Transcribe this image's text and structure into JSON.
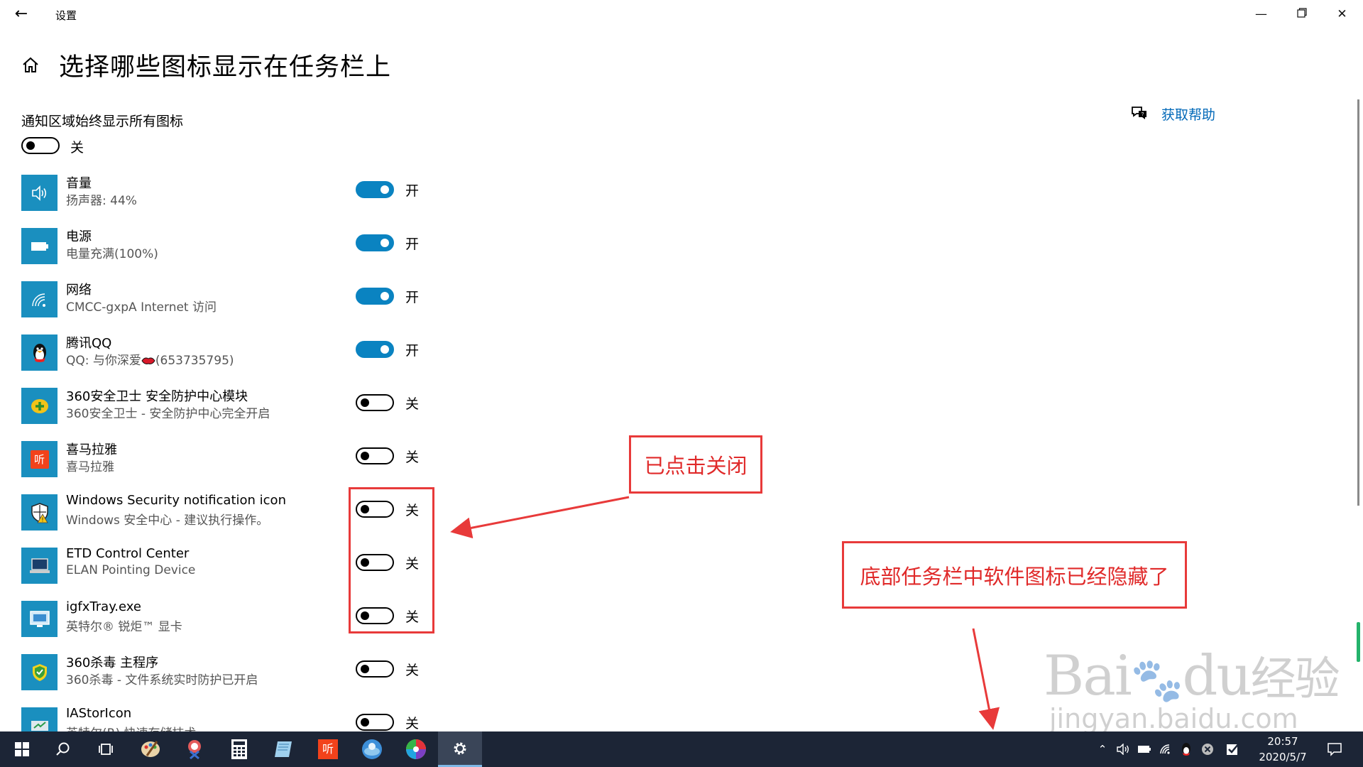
{
  "window": {
    "title": "设置",
    "back_icon": "back-arrow-icon",
    "controls": [
      "minimize-icon",
      "restore-icon",
      "close-icon"
    ]
  },
  "header": {
    "title": "选择哪些图标显示在任务栏上",
    "help_label": "获取帮助"
  },
  "always_show": {
    "label": "通知区域始终显示所有图标",
    "state": "关"
  },
  "items": [
    {
      "name": "音量",
      "desc": "扬声器: 44%",
      "state": "开",
      "on": true,
      "icon": "speaker-icon"
    },
    {
      "name": "电源",
      "desc": "电量充满(100%)",
      "state": "开",
      "on": true,
      "icon": "battery-icon"
    },
    {
      "name": "网络",
      "desc": "CMCC-gxpA Internet 访问",
      "state": "开",
      "on": true,
      "icon": "wifi-icon"
    },
    {
      "name": "腾讯QQ",
      "desc_prefix": "QQ: 与你深爱",
      "desc_suffix": "(653735795)",
      "state": "开",
      "on": true,
      "icon": "qq-penguin-icon"
    },
    {
      "name": "360安全卫士 安全防护中心模块",
      "desc": "360安全卫士 - 安全防护中心完全开启",
      "state": "关",
      "on": false,
      "icon": "shield-plus-icon"
    },
    {
      "name": "喜马拉雅",
      "desc": "喜马拉雅",
      "state": "关",
      "on": false,
      "icon": "ximalaya-icon"
    },
    {
      "name": "Windows Security notification icon",
      "desc": "Windows 安全中心 - 建议执行操作。",
      "state": "关",
      "on": false,
      "icon": "windows-security-icon"
    },
    {
      "name": "ETD Control Center",
      "desc": "ELAN Pointing Device",
      "state": "关",
      "on": false,
      "icon": "laptop-icon"
    },
    {
      "name": "igfxTray.exe",
      "desc": "英特尔® 锐炬™ 显卡",
      "state": "关",
      "on": false,
      "icon": "intel-graphics-icon"
    },
    {
      "name": "360杀毒 主程序",
      "desc": "360杀毒 - 文件系统实时防护已开启",
      "state": "关",
      "on": false,
      "icon": "antivirus-shield-icon"
    },
    {
      "name": "IAStorIcon",
      "desc": "英特尔(R) 快速存储技术",
      "state": "关",
      "on": false,
      "icon": "storage-icon"
    }
  ],
  "annotations": {
    "clicked_closed": "已点击关闭",
    "taskbar_hidden": "底部任务栏中软件图标已经隐藏了"
  },
  "watermark": {
    "brand": "Bai",
    "brand2": "du",
    "brand_cn": "经验",
    "url": "jingyan.baidu.com"
  },
  "taskbar": {
    "apps": [
      "windows-start-icon",
      "search-icon",
      "task-view-icon",
      "paint-icon",
      "snipping-icon",
      "calculator-icon",
      "notepad-icon",
      "ximalaya-app-icon",
      "browser-icon",
      "color-picker-icon",
      "settings-gear-icon"
    ],
    "tray": [
      "chevron-up-icon",
      "volume-icon",
      "battery-icon",
      "wifi-icon",
      "qq-icon",
      "close-circle-icon",
      "checkbox-icon"
    ],
    "time": "20:57",
    "date": "2020/5/7",
    "colors": {
      "bar": "#1c2536",
      "accent": "#0a83c1",
      "annotation": "#e83a3a"
    }
  }
}
